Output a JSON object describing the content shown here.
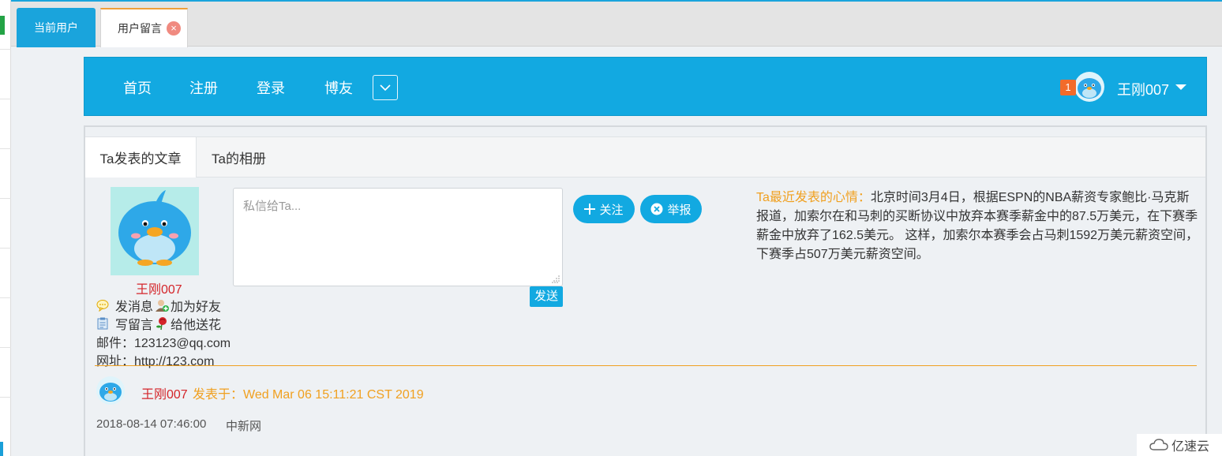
{
  "tabs": {
    "current_label": "当前用户",
    "active_label": "用户留言",
    "close_glyph": "×"
  },
  "navbar": {
    "items": [
      "首页",
      "注册",
      "登录",
      "博友"
    ],
    "badge_count": "1",
    "username": "王刚007"
  },
  "subtabs": [
    "Ta发表的文章",
    "Ta的相册"
  ],
  "profile": {
    "name": "王刚007",
    "send_message": "发消息",
    "add_friend": "加为好友",
    "write_comment": "写留言",
    "send_flower": "给他送花",
    "email": "邮件：123123@qq.com",
    "website": "网址：http://123.com"
  },
  "private_message": {
    "placeholder": "私信给Ta...",
    "send_label": "发送"
  },
  "buttons": {
    "follow": "关注",
    "report": "举报"
  },
  "mood": {
    "label": "Ta最近发表的心情：",
    "text": "北京时间3月4日，根据ESPN的NBA薪资专家鲍比·马克斯报道，加索尔在和马刺的买断协议中放弃本赛季薪金中的87.5万美元，在下赛季薪金中放弃了162.5美元。 这样，加索尔本赛季会占马刺1592万美元薪资空间，下赛季占507万美元薪资空间。"
  },
  "post": {
    "author": "王刚007",
    "posted_at": "发表于：Wed Mar 06 15:11:21 CST 2019",
    "date": "2018-08-14 07:46:00",
    "source": "中新网"
  },
  "watermark": "亿速云",
  "colors": {
    "primary": "#12a9e1",
    "accent_orange": "#f0a020",
    "name_red": "#d4252a",
    "badge": "#f26b2a"
  },
  "icons": [
    "chevron-down-icon",
    "close-icon",
    "bird-avatar-icon",
    "chat-bubble-icon",
    "add-friend-icon",
    "clipboard-icon",
    "rose-icon",
    "plus-icon",
    "close-circle-icon",
    "resize-handle-icon",
    "cloud-logo-icon"
  ]
}
